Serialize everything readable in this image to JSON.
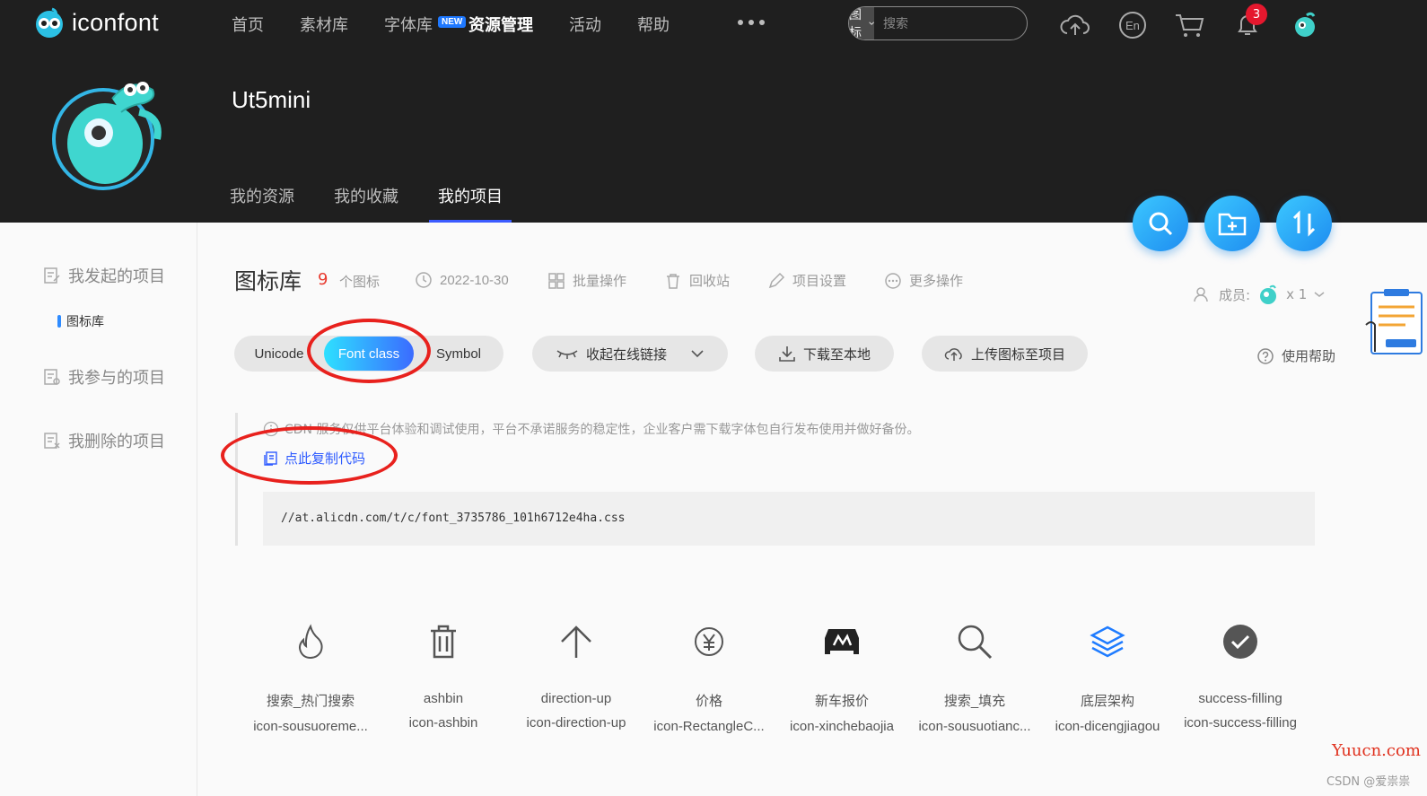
{
  "brand": {
    "logo_text": "iconfont"
  },
  "topnav": {
    "items": [
      {
        "label": "首页",
        "active": false
      },
      {
        "label": "素材库",
        "active": false
      },
      {
        "label": "字体库",
        "active": false
      },
      {
        "label": "资源管理",
        "active": true
      },
      {
        "label": "活动",
        "active": false
      },
      {
        "label": "帮助",
        "active": false
      }
    ],
    "new_badge": "NEW",
    "search_type": "图标",
    "search_placeholder": "搜索",
    "notification_count": "3"
  },
  "profile": {
    "username": "Ut5mini",
    "tabs": [
      {
        "label": "我的资源",
        "active": false
      },
      {
        "label": "我的收藏",
        "active": false
      },
      {
        "label": "我的项目",
        "active": true
      }
    ]
  },
  "sidebar": {
    "groups": [
      {
        "label": "我发起的项目"
      },
      {
        "label": "我参与的项目"
      },
      {
        "label": "我删除的项目"
      }
    ],
    "active_sub": "图标库"
  },
  "project": {
    "title": "图标库",
    "count": "9",
    "count_label": "个图标",
    "date": "2022-10-30",
    "actions": {
      "batch": "批量操作",
      "recycle": "回收站",
      "settings": "项目设置",
      "more": "更多操作"
    },
    "members_label": "成员:",
    "members_count": "x 1",
    "help": "使用帮助"
  },
  "toolbar": {
    "modes": [
      "Unicode",
      "Font class",
      "Symbol"
    ],
    "active_mode": "Font class",
    "collapse_link": "收起在线链接",
    "download": "下载至本地",
    "upload": "上传图标至项目"
  },
  "cdn": {
    "notice": "CDN 服务仅供平台体验和调试使用，平台不承诺服务的稳定性，企业客户需下载字体包自行发布使用并做好备份。",
    "copy_label": "点此复制代码",
    "code": "//at.alicdn.com/t/c/font_3735786_101h6712e4ha.css"
  },
  "icons": [
    {
      "name": "搜索_热门搜索",
      "code": "icon-sousuoreme...",
      "glyph": "fire-icon"
    },
    {
      "name": "ashbin",
      "code": "icon-ashbin",
      "glyph": "trash-icon"
    },
    {
      "name": "direction-up",
      "code": "icon-direction-up",
      "glyph": "arrow-up-icon"
    },
    {
      "name": "价格",
      "code": "icon-RectangleC...",
      "glyph": "yen-icon"
    },
    {
      "name": "新车报价",
      "code": "icon-xinchebaojia",
      "glyph": "car-icon"
    },
    {
      "name": "搜索_填充",
      "code": "icon-sousuotianc...",
      "glyph": "search-icon"
    },
    {
      "name": "底层架构",
      "code": "icon-dicengjiagou",
      "glyph": "layers-icon"
    },
    {
      "name": "success-filling",
      "code": "icon-success-filling",
      "glyph": "check-circle-icon"
    }
  ],
  "colors": {
    "accent": "#2e5bff",
    "header_bg": "#1f1f1f",
    "count_red": "#e8392e",
    "annotation_red": "#e8211d"
  },
  "watermarks": {
    "site": "Yuucn.com",
    "csdn": "CSDN @爱祟祟"
  }
}
